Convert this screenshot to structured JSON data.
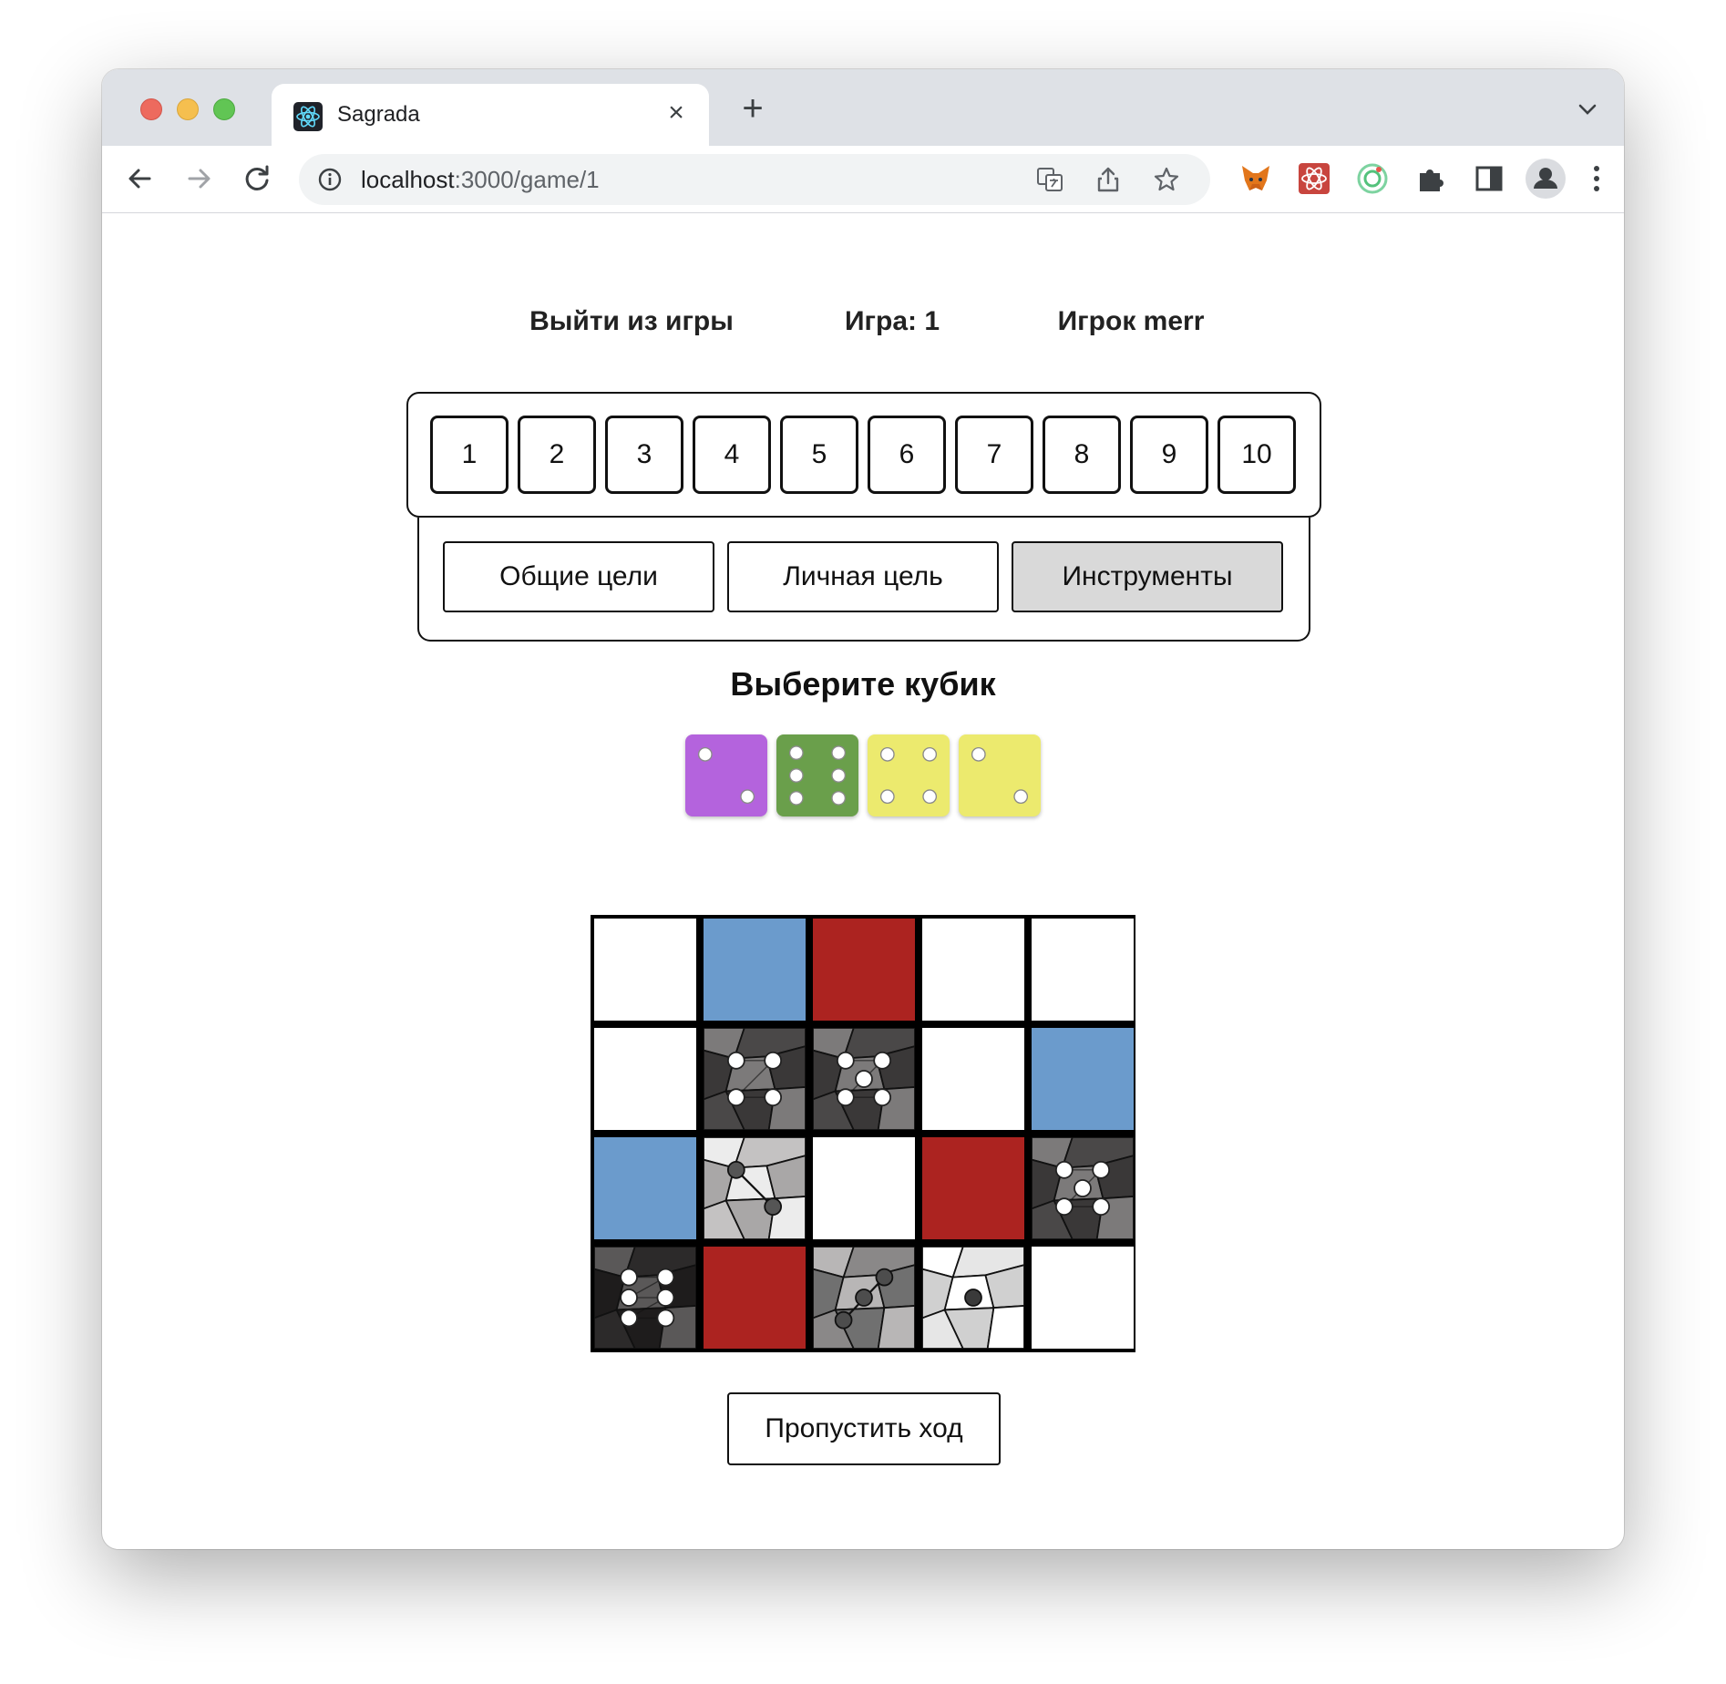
{
  "browser": {
    "tab_title": "Sagrada",
    "url_host": "localhost",
    "url_path": ":3000/game/1"
  },
  "header": {
    "exit_label": "Выйти из игры",
    "game_label": "Игра: 1",
    "player_label": "Игрок merr"
  },
  "rounds": [
    "1",
    "2",
    "3",
    "4",
    "5",
    "6",
    "7",
    "8",
    "9",
    "10"
  ],
  "goal_tabs": [
    {
      "label": "Общие цели",
      "active": false
    },
    {
      "label": "Личная цель",
      "active": false
    },
    {
      "label": "Инструменты",
      "active": true
    }
  ],
  "draft_title": "Выберите кубик",
  "draft_dice": [
    {
      "color": "purple",
      "hex": "#b463dd",
      "value": 2
    },
    {
      "color": "green",
      "hex": "#6a9f4b",
      "value": 6
    },
    {
      "color": "yellow",
      "hex": "#ecea6e",
      "value": 4
    },
    {
      "color": "yellow",
      "hex": "#ecea6e",
      "value": 2
    }
  ],
  "board": {
    "rows": 4,
    "cols": 5,
    "cells": [
      {
        "type": "blank"
      },
      {
        "type": "color",
        "color": "blue"
      },
      {
        "type": "color",
        "color": "red"
      },
      {
        "type": "blank"
      },
      {
        "type": "blank"
      },
      {
        "type": "blank"
      },
      {
        "type": "shade",
        "value": 4,
        "tone": "dark"
      },
      {
        "type": "shade",
        "value": 5,
        "tone": "dark"
      },
      {
        "type": "blank"
      },
      {
        "type": "color",
        "color": "blue"
      },
      {
        "type": "color",
        "color": "blue"
      },
      {
        "type": "shade",
        "value": 2,
        "tone": "light"
      },
      {
        "type": "blank"
      },
      {
        "type": "color",
        "color": "red"
      },
      {
        "type": "shade",
        "value": 5,
        "tone": "dark"
      },
      {
        "type": "shade",
        "value": 6,
        "tone": "darkest"
      },
      {
        "type": "color",
        "color": "red"
      },
      {
        "type": "shade",
        "value": 3,
        "tone": "medium"
      },
      {
        "type": "shade",
        "value": 1,
        "tone": "lightest"
      },
      {
        "type": "blank"
      }
    ]
  },
  "colors": {
    "blue": "#6b9bcc",
    "red": "#ac2320",
    "active_tab_bg": "#d9d9d9"
  },
  "skip_label": "Пропустить ход"
}
